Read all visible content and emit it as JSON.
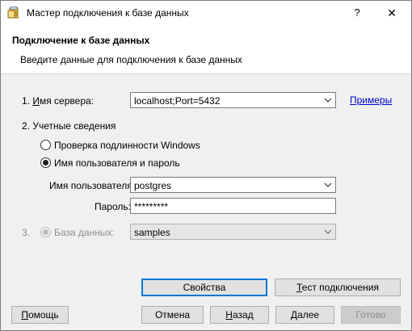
{
  "window": {
    "title": "Мастер подключения к базе данных",
    "help": "?",
    "close": "✕"
  },
  "header": {
    "title": "Подключение к базе данных",
    "subtitle": "Введите данные для подключения к базе данных"
  },
  "server": {
    "label_prefix": "1. ",
    "label_mnemonic": "И",
    "label_rest": "мя сервера:",
    "value": "localhost;Port=5432",
    "examples_link": "Примеры"
  },
  "credentials": {
    "section_label": "2. Учетные сведения",
    "option_windows": "Проверка подлинности Windows",
    "option_userpass": "Имя пользователя и пароль",
    "selected": "userpass",
    "username_label": "Имя пользователя:",
    "username_value": "postgres",
    "password_label": "Пароль:",
    "password_value": "*********"
  },
  "database": {
    "number": "3.",
    "label": "База данных:",
    "value": "samples"
  },
  "buttons": {
    "properties": "Свойства",
    "test_prefix": "",
    "test_mnemonic": "Т",
    "test_rest": "ест подключения",
    "help_mnemonic": "П",
    "help_rest": "омощь",
    "cancel": "Отмена",
    "back_mnemonic": "Н",
    "back_rest": "азад",
    "next_mnemonic": "Д",
    "next_rest": "алее",
    "finish": "Готово"
  },
  "colors": {
    "link": "#0000cc",
    "default_button_border": "#0078d7",
    "app_icon_yellow": "#e8b83a"
  },
  "icons": {
    "app": "database-wizard-icon",
    "dropdown": "chevron-down-icon"
  }
}
